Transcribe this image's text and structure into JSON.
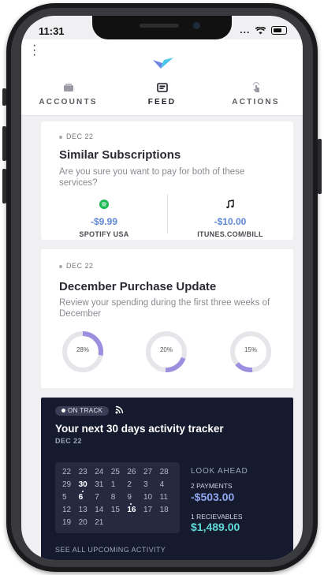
{
  "status": {
    "time": "11:31",
    "icons": "..."
  },
  "nav": {
    "tabs": [
      {
        "label": "ACCOUNTS",
        "icon": "wallet-icon"
      },
      {
        "label": "FEED",
        "icon": "feed-icon",
        "active": true
      },
      {
        "label": "ACTIONS",
        "icon": "tap-icon"
      }
    ]
  },
  "subscriptions_card": {
    "date": "DEC 22",
    "title": "Similar Subscriptions",
    "description": "Are you sure you want to pay for both of these services?",
    "items": [
      {
        "amount": "-$9.99",
        "name": "SPOTIFY USA",
        "icon": "spotify-icon"
      },
      {
        "amount": "-$10.00",
        "name": "ITUNES.COM/BILL",
        "icon": "music-note-icon"
      }
    ]
  },
  "purchase_card": {
    "date": "DEC 22",
    "title": "December Purchase Update",
    "description": "Review your spending during the first three weeks of December",
    "donuts": [
      {
        "label": "28%",
        "value": 28
      },
      {
        "label": "20%",
        "value": 20
      },
      {
        "label": "15%",
        "value": 15
      }
    ]
  },
  "tracker_card": {
    "badge": "ON TRACK",
    "title": "Your next 30 days activity tracker",
    "date": "DEC 22",
    "calendar_rows": [
      [
        "22",
        "23",
        "24",
        "25",
        "26",
        "27",
        "28"
      ],
      [
        "29",
        "30",
        "31",
        "1",
        "2",
        "3",
        "4"
      ],
      [
        "5",
        "6",
        "7",
        "8",
        "9",
        "10",
        "11"
      ],
      [
        "12",
        "13",
        "14",
        "15",
        "16",
        "17",
        "18"
      ],
      [
        "19",
        "20",
        "21"
      ]
    ],
    "look_ahead": "LOOK AHEAD",
    "payments_label": "2 PAYMENTS",
    "payments_amount": "-$503.00",
    "receivables_label": "1 RECIEVABLES",
    "receivables_amount": "$1,489.00",
    "see_all": "SEE ALL UPCOMING ACTIVITY"
  },
  "colors": {
    "accent_blue": "#5f88d4",
    "donut_purple": "#9b8fe0",
    "dark_card": "#161a2e",
    "teal": "#5ed9d6"
  }
}
